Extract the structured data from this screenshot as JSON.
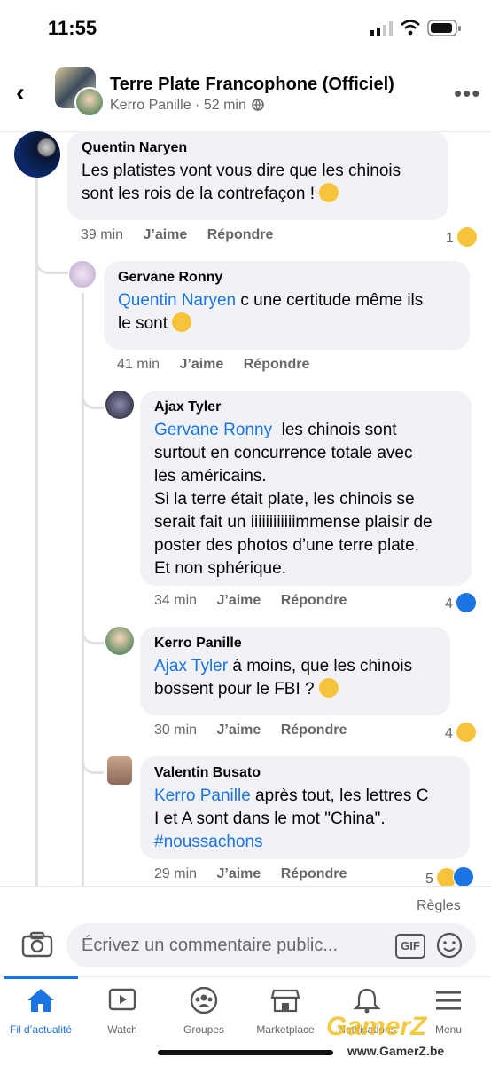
{
  "status": {
    "time": "11:55"
  },
  "header": {
    "title": "Terre Plate Francophone (Officiel)",
    "author": "Kerro Panille",
    "age": "52 min"
  },
  "comments": [
    {
      "name": "Quentin Naryen",
      "mention": "",
      "text": "Les platistes vont vous dire que les chinois\nsont les rois de la contrefaçon ! ",
      "time": "39 min",
      "like": "J’aime",
      "reply": "Répondre",
      "reactions": "1",
      "reaction_types": [
        "haha"
      ]
    },
    {
      "name": "Gervane Ronny",
      "mention": "Quentin Naryen",
      "text": " c une certitude même ils\nle sont ",
      "time": "41 min",
      "like": "J’aime",
      "reply": "Répondre",
      "reactions": "",
      "reaction_types": []
    },
    {
      "name": "Ajax Tyler",
      "mention": "Gervane Ronny",
      "text": "  les chinois sont\nsurtout en concurrence totale avec\nles américains.\nSi la terre était plate, les chinois se\nserait fait un iiiiiiiiiiiimmense plaisir de\nposter des photos d’une terre plate.\nEt non sphérique.",
      "time": "34 min",
      "like": "J’aime",
      "reply": "Répondre",
      "reactions": "4",
      "reaction_types": [
        "like"
      ]
    },
    {
      "name": "Kerro Panille",
      "mention": "Ajax Tyler",
      "text": " à moins, que les chinois\nbossent pour le FBI ? ",
      "time": "30 min",
      "like": "J’aime",
      "reply": "Répondre",
      "reactions": "4",
      "reaction_types": [
        "haha"
      ]
    },
    {
      "name": "Valentin Busato",
      "mention": "Kerro Panille",
      "text": " après tout, les lettres C\nI et A sont dans le mot \"China\".",
      "hashtag": "#noussachons",
      "time": "29 min",
      "like": "J’aime",
      "reply": "Répondre",
      "reactions": "5",
      "reaction_types": [
        "haha",
        "like"
      ]
    }
  ],
  "composer": {
    "rules": "Règles",
    "placeholder": "Écrivez un commentaire public...",
    "gif": "GIF"
  },
  "tabs": [
    {
      "label": "Fil d’actualité",
      "icon": "home-icon",
      "active": true
    },
    {
      "label": "Watch",
      "icon": "watch-icon",
      "active": false
    },
    {
      "label": "Groupes",
      "icon": "groups-icon",
      "active": false
    },
    {
      "label": "Marketplace",
      "icon": "marketplace-icon",
      "active": false
    },
    {
      "label": "Notifications",
      "icon": "bell-icon",
      "active": false
    },
    {
      "label": "Menu",
      "icon": "menu-icon",
      "active": false
    }
  ],
  "watermark": {
    "logo": "GamerZ",
    "url": "www.GamerZ.be"
  },
  "colors": {
    "accent": "#1b74e4",
    "bubble": "#f0f2f5",
    "meta": "#65676b"
  }
}
